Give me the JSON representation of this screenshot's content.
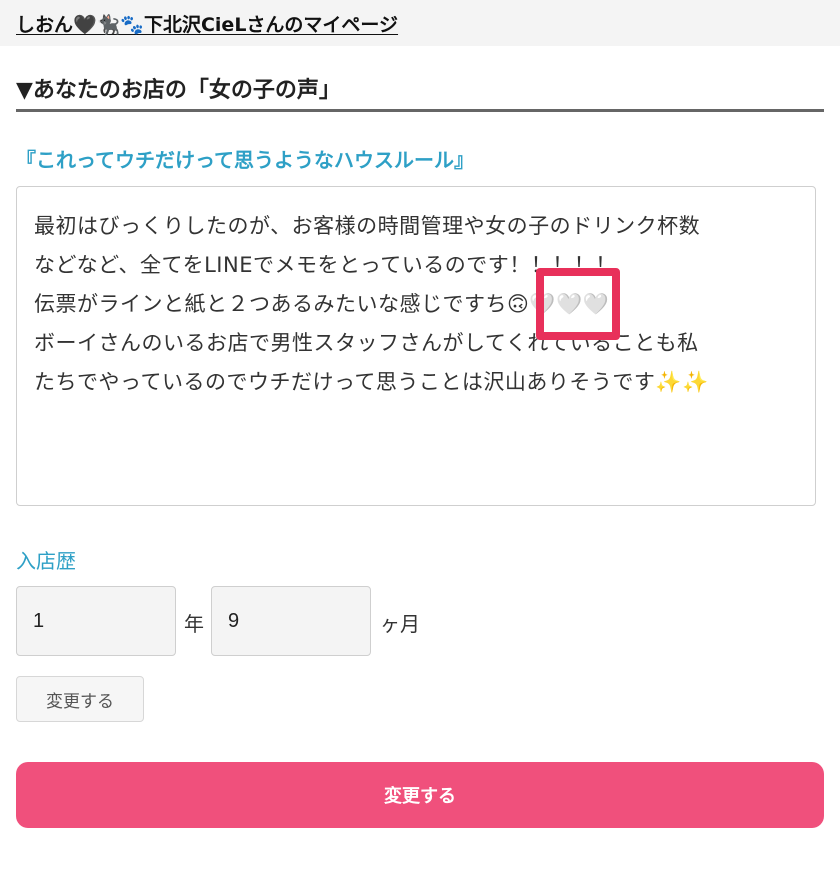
{
  "header": {
    "mypage_link": "しおん🖤🐈‍⬛🐾下北沢CieLさんのマイページ"
  },
  "section": {
    "heading": "▼あなたのお店の「女の子の声」"
  },
  "question": {
    "title": "『これってウチだけって思うようなハウスルール』",
    "answer_lines": [
      "最初はびっくりしたのが、お客様の時間管理や女の子のドリンク杯数",
      "などなど、全てをLINEでメモをとっているのです！！！！！",
      "伝票がラインと紙と２つあるみたいな感じですち🙃🤍🤍🤍",
      "ボーイさんのいるお店で男性スタッフさんがしてくれていることも私",
      "たちでやっているのでウチだけって思うことは沢山ありそうです✨✨"
    ]
  },
  "tenure": {
    "label": "入店歴",
    "years_value": "1",
    "years_unit": "年",
    "months_value": "9",
    "months_unit": "ヶ月",
    "change_label": "変更する"
  },
  "submit": {
    "label": "変更する"
  },
  "colors": {
    "accent_blue": "#2ea0c6",
    "submit_pink": "#f0507c",
    "highlight_red": "#e8305a"
  }
}
